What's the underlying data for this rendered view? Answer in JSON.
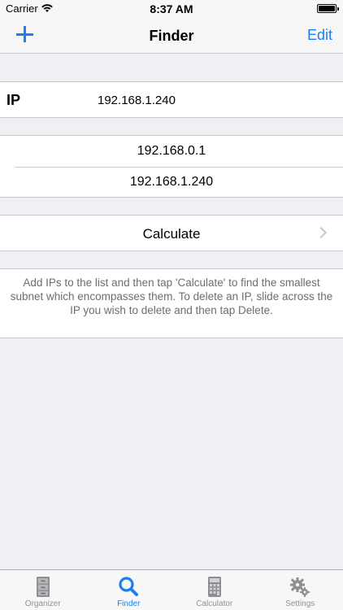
{
  "status_bar": {
    "carrier": "Carrier",
    "time": "8:37 AM"
  },
  "nav": {
    "title": "Finder",
    "edit_label": "Edit"
  },
  "ip_row": {
    "label": "IP",
    "value": "192.168.1.240"
  },
  "ip_list": [
    "192.168.0.1",
    "192.168.1.240"
  ],
  "calculate_label": "Calculate",
  "info_text": "Add IPs to the list and then tap 'Calculate' to find the smallest subnet which encompasses them. To delete an IP, slide across the IP you wish to delete and then tap Delete.",
  "tabs": [
    {
      "label": "Organizer",
      "icon": "filing-cabinet-icon",
      "active": false
    },
    {
      "label": "Finder",
      "icon": "search-icon",
      "active": true
    },
    {
      "label": "Calculator",
      "icon": "calculator-icon",
      "active": false
    },
    {
      "label": "Settings",
      "icon": "gear-icon",
      "active": false
    }
  ],
  "colors": {
    "accent": "#1a7ff0",
    "inactive_tab": "#929292",
    "background": "#efeff4"
  }
}
